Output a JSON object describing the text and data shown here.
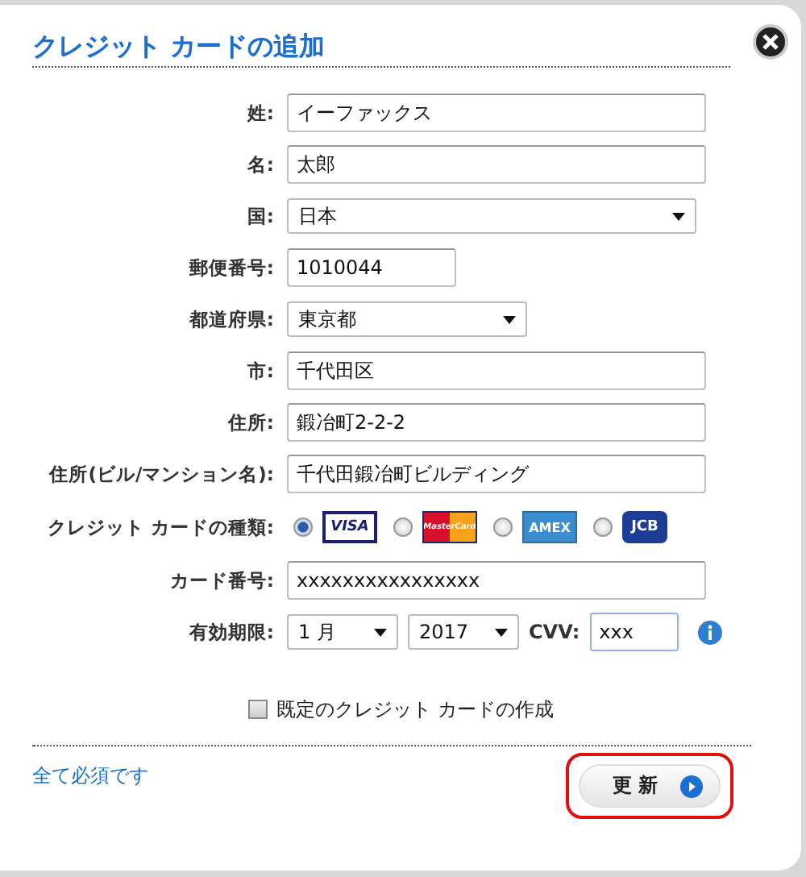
{
  "dialog": {
    "title": "クレジット カードの追加"
  },
  "fields": [
    {
      "kind": "text",
      "label": "姓:",
      "value": "イーファックス"
    },
    {
      "kind": "text",
      "label": "名:",
      "value": "太郎"
    },
    {
      "kind": "select",
      "label": "国:",
      "value": "日本"
    },
    {
      "kind": "short_text",
      "label": "郵便番号:",
      "value": "1010044"
    },
    {
      "kind": "short_select",
      "label": "都道府県:",
      "value": "東京都"
    },
    {
      "kind": "text",
      "label": "市:",
      "value": "千代田区"
    },
    {
      "kind": "text",
      "label": "住所:",
      "value": "鍛冶町2-2-2"
    },
    {
      "kind": "text",
      "label": "住所(ビル/マンション名):",
      "value": "千代田鍛冶町ビルディング"
    },
    {
      "kind": "card_type",
      "label": "クレジット カードの種類:",
      "options": [
        {
          "label": "VISA",
          "selected": true
        },
        {
          "label": "MasterCard",
          "selected": false
        },
        {
          "label": "AMEX",
          "selected": false
        },
        {
          "label": "JCB",
          "selected": false
        }
      ]
    },
    {
      "kind": "text",
      "label": "カード番号:",
      "value": "xxxxxxxxxxxxxxxx"
    },
    {
      "kind": "expiry",
      "label": "有効期限:",
      "month": "1 月",
      "year": "2017",
      "cvv_label": "CVV:",
      "cvv": "xxx"
    }
  ],
  "default_card": {
    "label": "既定のクレジット カードの作成",
    "checked": false
  },
  "footer": {
    "note": "全て必須です",
    "button": {
      "label": "更 新",
      "highlighted": true
    }
  }
}
